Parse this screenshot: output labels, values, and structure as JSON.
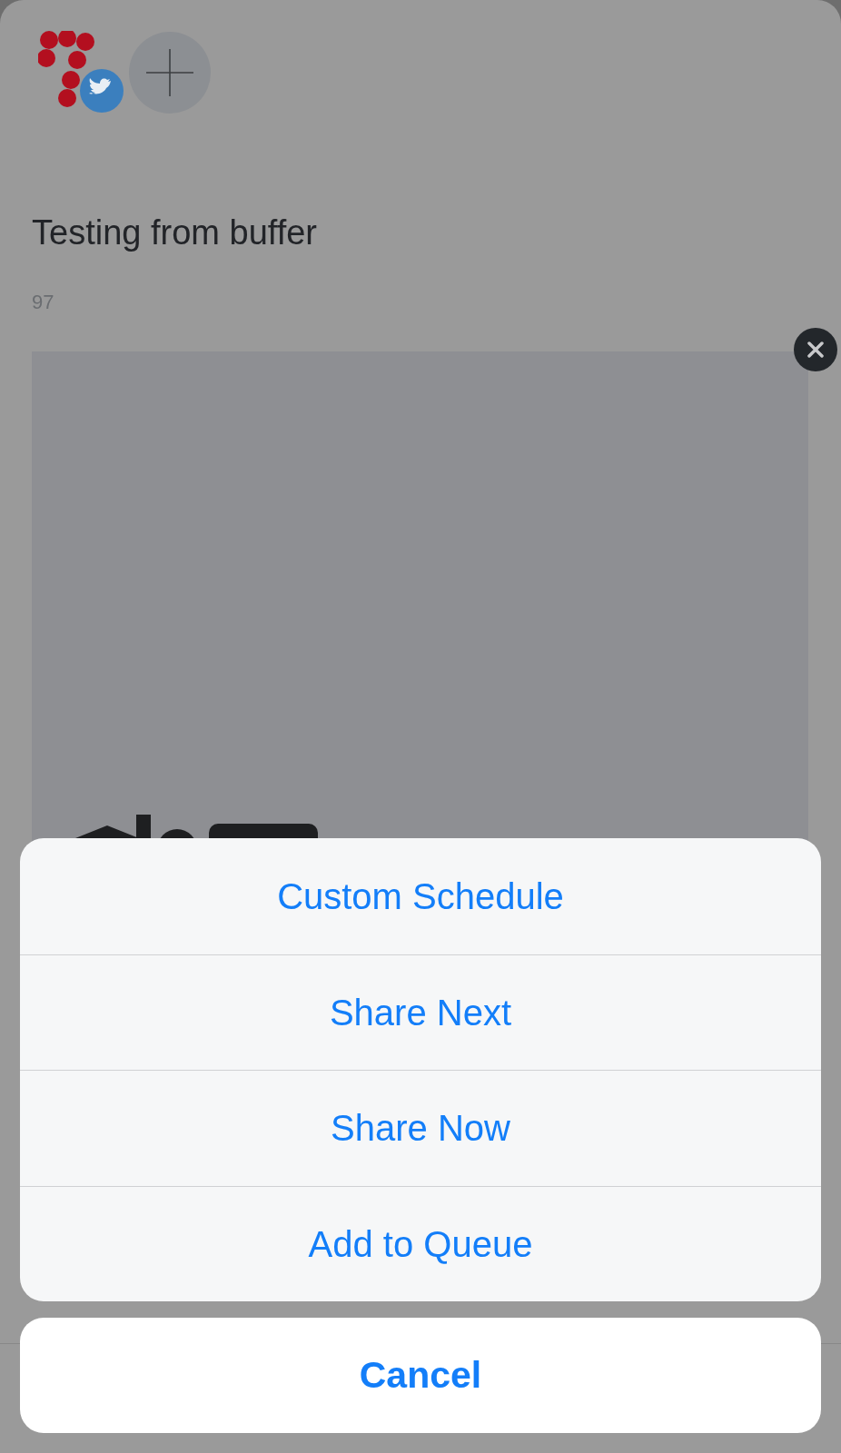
{
  "post": {
    "text": "Testing from buffer",
    "char_count": "97"
  },
  "action_sheet": {
    "actions": [
      "Custom Schedule",
      "Share Next",
      "Share Now",
      "Add to Queue"
    ],
    "cancel": "Cancel"
  }
}
